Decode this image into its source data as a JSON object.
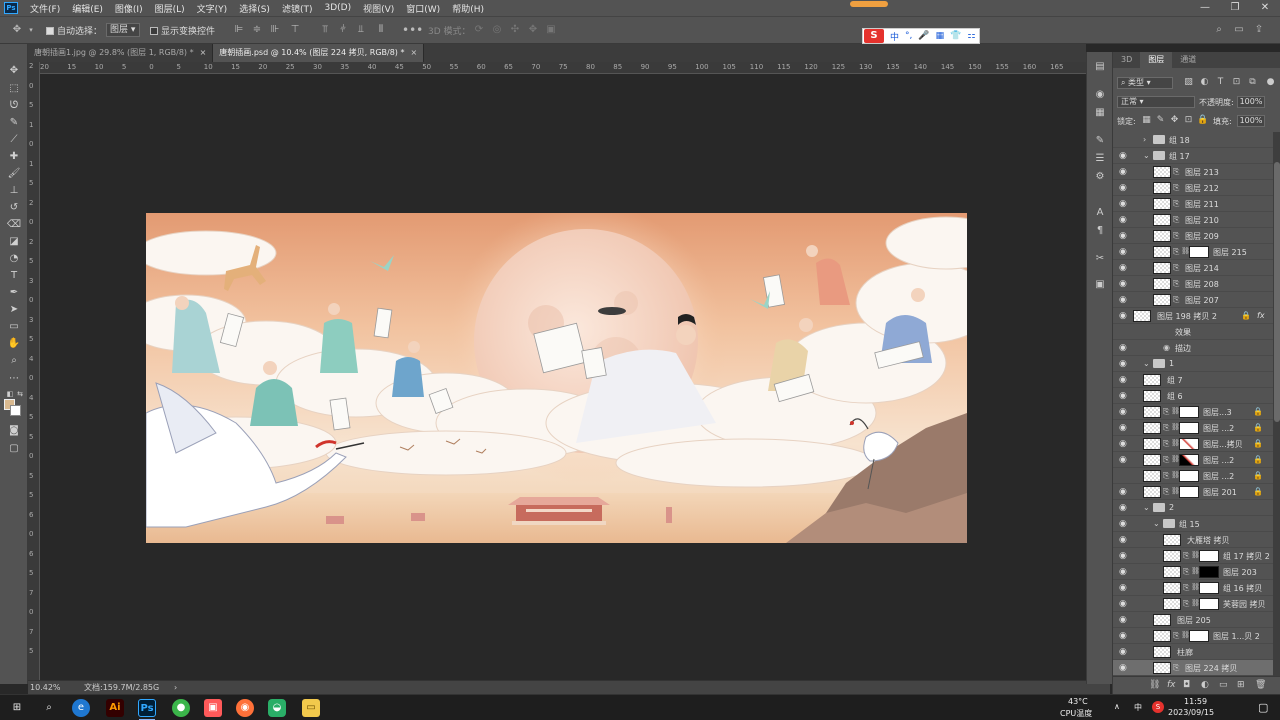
{
  "app": {
    "logo": "Ps",
    "name": "Adobe Photoshop"
  },
  "menu": [
    "文件(F)",
    "编辑(E)",
    "图像(I)",
    "图层(L)",
    "文字(Y)",
    "选择(S)",
    "滤镜(T)",
    "3D(D)",
    "视图(V)",
    "窗口(W)",
    "帮助(H)"
  ],
  "window_controls": {
    "minimize": "—",
    "restore": "❐",
    "close": "✕"
  },
  "options": {
    "auto_select_label": "自动选择：",
    "auto_select_value": "图层",
    "show_transform_label": "显示变换控件",
    "mode_3d_label": "3D 模式："
  },
  "ime": {
    "logo": "S",
    "chars": [
      "中",
      "°,",
      "🎤",
      "▦",
      "👕",
      "⚏"
    ]
  },
  "tabs": [
    {
      "label": "唐朝插画1.jpg @ 29.8% (图层 1, RGB/8) *",
      "close": "×",
      "active": false
    },
    {
      "label": "唐朝插画.psd @ 10.4% (图层 224 拷贝, RGB/8) *",
      "close": "×",
      "active": true
    }
  ],
  "ruler_h": [
    "20",
    "15",
    "10",
    "5",
    "0",
    "5",
    "10",
    "15",
    "20",
    "25",
    "30",
    "35",
    "40",
    "45",
    "50",
    "55",
    "60",
    "65",
    "70",
    "75",
    "80",
    "85",
    "90",
    "95",
    "100",
    "105",
    "110",
    "115",
    "120",
    "125",
    "130",
    "135",
    "140",
    "145",
    "150",
    "155",
    "160",
    "165"
  ],
  "ruler_v": [
    "2",
    "0",
    "5",
    "1",
    "0",
    "1",
    "5",
    "2",
    "0",
    "2",
    "5",
    "3",
    "0",
    "3",
    "5",
    "4",
    "0",
    "4",
    "5",
    "5",
    "0",
    "5",
    "5",
    "6",
    "0",
    "6",
    "5",
    "7",
    "0",
    "7",
    "5"
  ],
  "status": {
    "zoom": "10.42%",
    "doc": "文档:159.7M/2.85G",
    "arrow": "›"
  },
  "panel": {
    "tabs": [
      "3D",
      "图层",
      "通道"
    ],
    "kind": "类型",
    "blend_mode": "正常",
    "opacity_label": "不透明度:",
    "opacity": "100%",
    "lock_label": "锁定:",
    "fill_label": "填充:",
    "fill": "100%"
  },
  "layers": [
    {
      "name": "组 18",
      "kind": "group",
      "indent": 1,
      "caret": "›",
      "eye": false
    },
    {
      "name": "组 17",
      "kind": "group",
      "indent": 1,
      "caret": "⌄",
      "eye": true
    },
    {
      "name": "图层 213",
      "kind": "layer",
      "indent": 2,
      "eye": true
    },
    {
      "name": "图层 212",
      "kind": "layer",
      "indent": 2,
      "eye": true
    },
    {
      "name": "图层 211",
      "kind": "layer",
      "indent": 2,
      "eye": true
    },
    {
      "name": "图层 210",
      "kind": "layer",
      "indent": 2,
      "eye": true
    },
    {
      "name": "图层 209",
      "kind": "layer",
      "indent": 2,
      "eye": true
    },
    {
      "name": "图层 215",
      "kind": "masked",
      "indent": 2,
      "eye": true
    },
    {
      "name": "图层 214",
      "kind": "layer",
      "indent": 2,
      "eye": true
    },
    {
      "name": "图层 208",
      "kind": "layer",
      "indent": 2,
      "eye": true
    },
    {
      "name": "图层 207",
      "kind": "layer",
      "indent": 2,
      "eye": true
    },
    {
      "name": "图层 198 拷贝 2",
      "kind": "fx",
      "indent": 0,
      "eye": true
    },
    {
      "name": "效果",
      "kind": "effect",
      "indent": 3,
      "eye": false
    },
    {
      "name": "描边",
      "kind": "effect2",
      "indent": 3,
      "eye": true
    },
    {
      "name": "1",
      "kind": "group",
      "indent": 1,
      "caret": "⌄",
      "eye": true
    },
    {
      "name": "组 7",
      "kind": "plain",
      "indent": 1,
      "eye": true
    },
    {
      "name": "组 6",
      "kind": "plain",
      "indent": 1,
      "eye": true
    },
    {
      "name": "图层...3",
      "kind": "masked",
      "indent": 1,
      "eye": true,
      "lock": true
    },
    {
      "name": "图层 ...2",
      "kind": "masked",
      "indent": 1,
      "eye": true,
      "lock": true
    },
    {
      "name": "图层...拷贝",
      "kind": "masked-red",
      "indent": 1,
      "eye": true,
      "lock": true
    },
    {
      "name": "图层 ...2",
      "kind": "masked-red2",
      "indent": 1,
      "eye": true,
      "lock": true
    },
    {
      "name": "图层 ...2",
      "kind": "masked",
      "indent": 1,
      "eye": false,
      "lock": true
    },
    {
      "name": "图层 201",
      "kind": "masked",
      "indent": 1,
      "eye": true,
      "lock": true
    },
    {
      "name": "2",
      "kind": "group",
      "indent": 1,
      "caret": "⌄",
      "eye": true
    },
    {
      "name": "组 15",
      "kind": "group",
      "indent": 2,
      "caret": "⌄",
      "eye": true
    },
    {
      "name": "大雁塔 拷贝",
      "kind": "plain",
      "indent": 3,
      "eye": true
    },
    {
      "name": "组 17 拷贝 2",
      "kind": "masked",
      "indent": 3,
      "eye": true
    },
    {
      "name": "图层 203",
      "kind": "masked-black",
      "indent": 3,
      "eye": true
    },
    {
      "name": "组 16 拷贝",
      "kind": "masked",
      "indent": 3,
      "eye": true
    },
    {
      "name": "芙蓉园 拷贝",
      "kind": "masked",
      "indent": 3,
      "eye": true
    },
    {
      "name": "图层 205",
      "kind": "plain",
      "indent": 2,
      "eye": true
    },
    {
      "name": "图层 1...贝 2",
      "kind": "masked",
      "indent": 2,
      "eye": true
    },
    {
      "name": "柱廊",
      "kind": "plain",
      "indent": 2,
      "eye": true
    },
    {
      "name": "图层 224 拷贝",
      "kind": "selected",
      "indent": 2,
      "eye": true
    }
  ],
  "taskbar": {
    "weather_temp": "43°C",
    "weather_label": "CPU温度",
    "time": "11:59",
    "date": "2023/09/15",
    "ime_tray": "中"
  },
  "colors": {
    "accent": "#31a8ff",
    "panel": "#535353",
    "canvas": "#282828",
    "sky_top": "#e9a37a",
    "sky_mid": "#f6d0ad",
    "moon": "#f5d5c0",
    "crane_red": "#d0342c"
  }
}
